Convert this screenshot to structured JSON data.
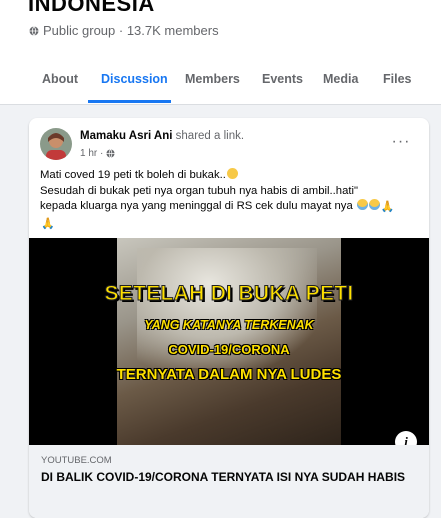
{
  "group": {
    "title": "INDONESIA",
    "privacy_icon": "globe-icon",
    "meta": "Public group · 13.7K members"
  },
  "tabs": [
    {
      "label": "About",
      "active": false
    },
    {
      "label": "Discussion",
      "active": true
    },
    {
      "label": "Members",
      "active": false
    },
    {
      "label": "Events",
      "active": false
    },
    {
      "label": "Media",
      "active": false
    },
    {
      "label": "Files",
      "active": false
    }
  ],
  "post": {
    "author": "Mamaku Asri Ani",
    "action": "shared a link.",
    "time": "1 hr ·",
    "audience_icon": "globe-icon",
    "more_icon": "more-options-icon",
    "more_label": "···",
    "text_line1": "Mati coved 19 peti tk boleh di bukak..",
    "text_line2": "Sesudah di bukak peti nya organ tubuh nya habis di ambil..hati\"",
    "text_line3": "kepada kluarga nya yang meninggal di RS cek dulu mayat nya",
    "emojis": [
      "grinning-sweat-emoji",
      "crying-face-emoji",
      "folded-hands-emoji"
    ]
  },
  "media": {
    "overlay_line1": "SETELAH DI BUKA PETI",
    "overlay_line2": "YANG KATANYA TERKENAK",
    "overlay_line3": "COVID-19/CORONA",
    "overlay_line4": "TERNYATA DALAM NYA LUDES",
    "info_label": "i"
  },
  "link": {
    "domain": "YOUTUBE.COM",
    "title": "DI BALIK COVID-19/CORONA TERNYATA ISI NYA SUDAH HABIS"
  },
  "colors": {
    "accent": "#1877f2",
    "secondary_text": "#65676b",
    "overlay_text": "#ffe100"
  }
}
